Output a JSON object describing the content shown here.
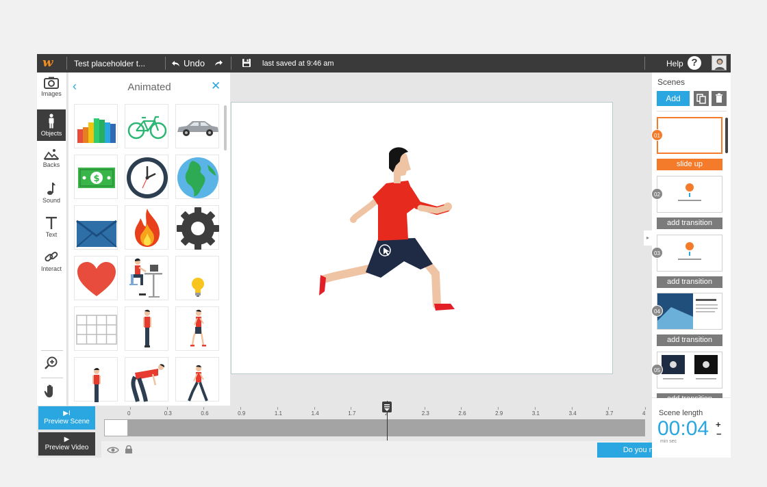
{
  "topbar": {
    "logo": "w",
    "doc_title": "Test placeholder t...",
    "undo_label": "Undo",
    "last_saved": "last saved at 9:46 am",
    "help_label": "Help",
    "help_glyph": "?"
  },
  "toolbar": {
    "items": [
      {
        "label": "Images",
        "icon": "camera-icon"
      },
      {
        "label": "Objects",
        "icon": "person-icon"
      },
      {
        "label": "Backs",
        "icon": "landscape-icon"
      },
      {
        "label": "Sound",
        "icon": "music-note-icon"
      },
      {
        "label": "Text",
        "icon": "text-icon"
      },
      {
        "label": "Interact",
        "icon": "link-icon"
      }
    ],
    "active": "Objects"
  },
  "library": {
    "back_glyph": "‹",
    "title": "Animated",
    "close_glyph": "✕",
    "items": [
      "bar-chart",
      "bicycle",
      "car",
      "dollar-bill",
      "clock",
      "globe",
      "envelope",
      "fire",
      "gear",
      "heart",
      "man-at-desk",
      "light-bulb",
      "grid-table",
      "man-standing",
      "man-walking",
      "man-standing-front",
      "man-bending",
      "man-striding"
    ]
  },
  "scenes": {
    "title": "Scenes",
    "add_label": "Add",
    "items": [
      {
        "num": "01",
        "button": "slide up",
        "active": true
      },
      {
        "num": "02",
        "button": "add transition",
        "active": false
      },
      {
        "num": "03",
        "button": "add transition",
        "active": false
      },
      {
        "num": "04",
        "button": "add transition",
        "active": false
      },
      {
        "num": "05",
        "button": "add transition",
        "active": false
      }
    ]
  },
  "preview": {
    "scene_icon": "▶I",
    "scene_label": "Preview Scene",
    "video_icon": "▶",
    "video_label": "Preview Video"
  },
  "timeline": {
    "ticks": [
      "0",
      "0.3",
      "0.6",
      "0.9",
      "1.1",
      "1.4",
      "1.7",
      "2",
      "2.3",
      "2.6",
      "2.9",
      "3.1",
      "3.4",
      "3.7",
      "4"
    ],
    "playhead_value": 2
  },
  "scene_length": {
    "label": "Scene length",
    "value": "00:04",
    "units": "min      sec",
    "plus": "+",
    "minus": "−"
  },
  "help_widget": {
    "label": "Do you need help?",
    "plus": "+"
  },
  "colors": {
    "accent_blue": "#2aa6e0",
    "active_orange": "#f47b2a",
    "topbar": "#3a3a3a"
  }
}
